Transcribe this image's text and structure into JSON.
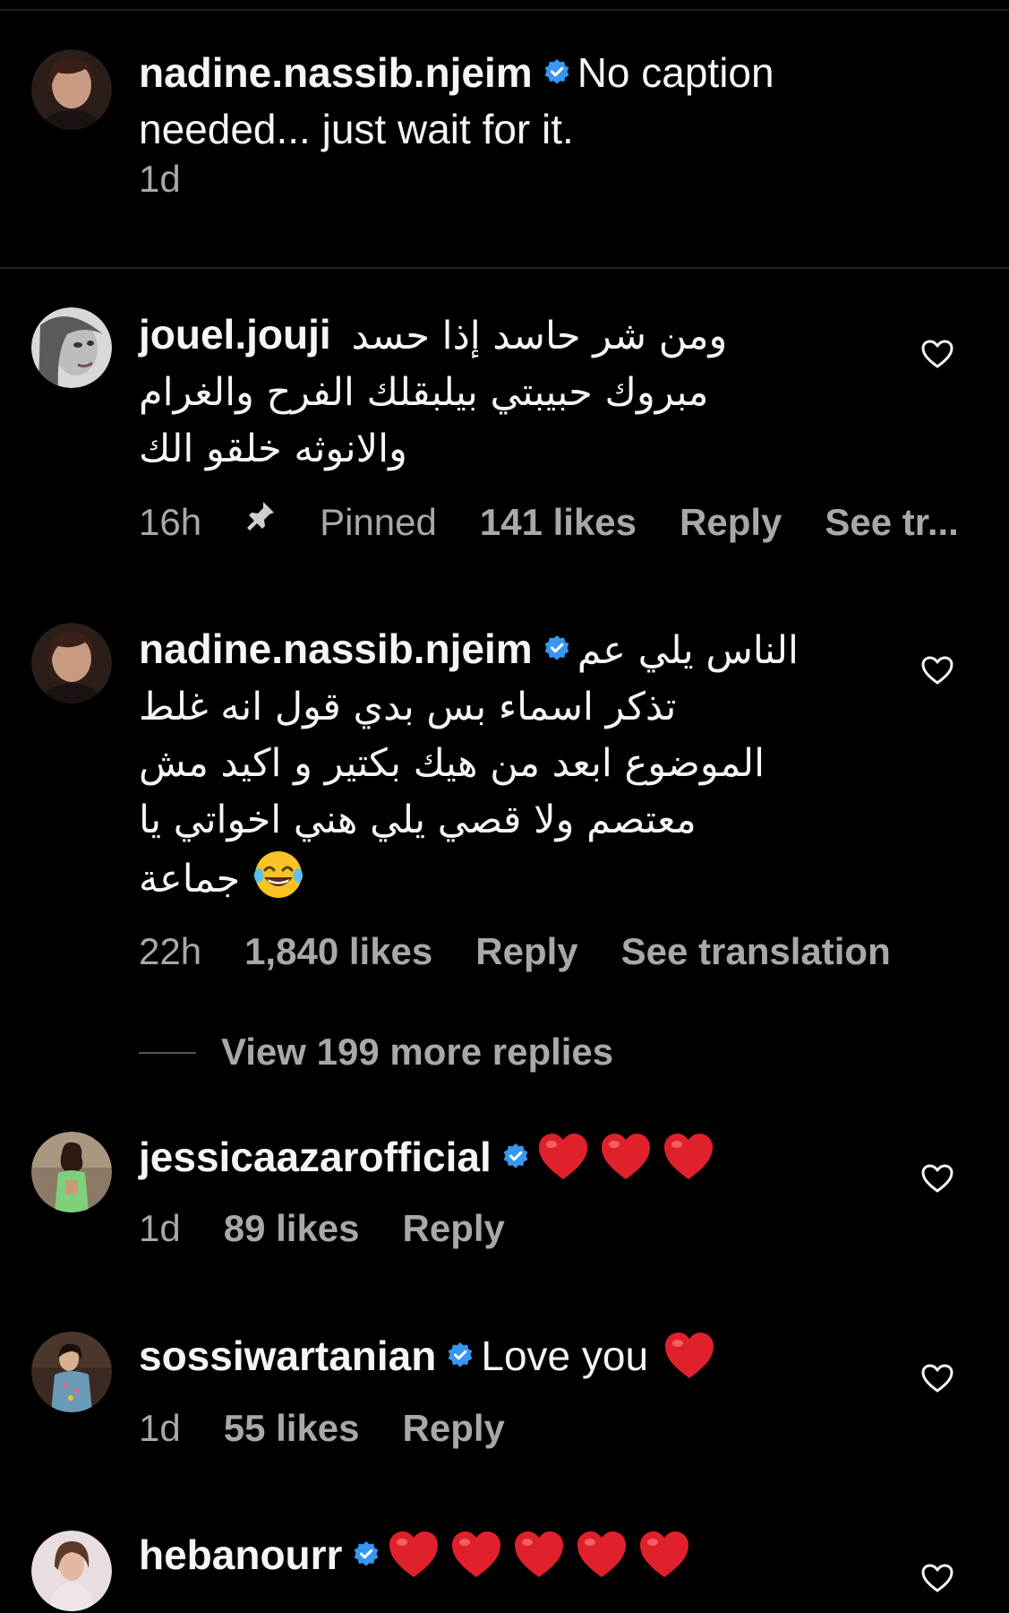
{
  "caption": {
    "username": "nadine.nassib.njeim",
    "text_line1": "No caption",
    "text_line2": "needed... just wait for it.",
    "time": "1d"
  },
  "comments": [
    {
      "username": "jouel.jouji",
      "verified": false,
      "text_lines": [
        "ومن شر حاسد إذا حسد",
        "مبروك حبيبتي بيلبقلك الفرح والغرام",
        "والانوثه خلقو الك"
      ],
      "time": "16h",
      "pinned_label": "Pinned",
      "likes": "141 likes",
      "reply": "Reply",
      "translation": "See tr..."
    },
    {
      "username": "nadine.nassib.njeim",
      "verified": true,
      "text_lines": [
        "الناس يلي عم",
        "تذكر اسماء بس بدي قول انه غلط",
        "الموضوع ابعد من هيك بكتير و اكيد مش",
        "معتصم ولا قصي يلي هني اخواتي يا",
        "جماعة"
      ],
      "time": "22h",
      "likes": "1,840 likes",
      "reply": "Reply",
      "translation": "See translation",
      "view_replies": "View 199 more replies"
    },
    {
      "username": "jessicaazarofficial",
      "verified": true,
      "time": "1d",
      "likes": "89 likes",
      "reply": "Reply"
    },
    {
      "username": "sossiwartanian",
      "verified": true,
      "text": "Love you",
      "time": "1d",
      "likes": "55 likes",
      "reply": "Reply"
    },
    {
      "username": "hebanourr",
      "verified": true
    }
  ],
  "colors": {
    "background": "#000000",
    "text": "#f5f5f5",
    "secondary": "#a8a8a8",
    "verified_blue": "#3897f0",
    "heart_red": "#e0202a"
  },
  "icons": [
    "verified-badge-icon",
    "heart-outline-icon",
    "pin-icon",
    "red-heart-emoji-icon",
    "laughing-emoji-icon"
  ]
}
